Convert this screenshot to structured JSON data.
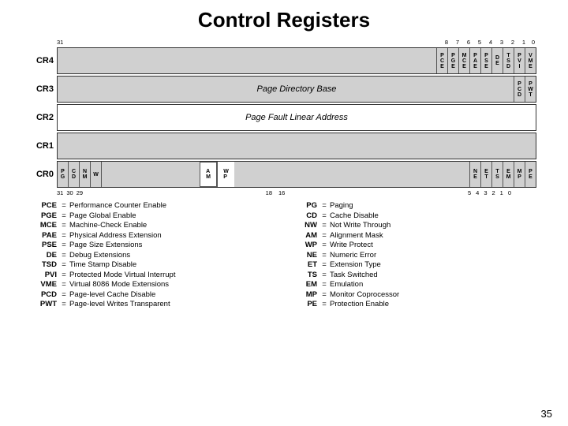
{
  "title": "Control Registers",
  "page_number": "35",
  "diagram": {
    "bit_labels": {
      "b31": "31",
      "b8": "8",
      "b7": "7",
      "b6": "6",
      "b5": "5",
      "b4": "4",
      "b3": "3",
      "b2": "2",
      "b1": "1",
      "b0": "0"
    },
    "bottom_bits": {
      "b31": "31",
      "b30": "30",
      "b29": "29",
      "b18": "18",
      "b16": "16",
      "b5": "5",
      "b4": "4",
      "b3": "3",
      "b2": "2",
      "b1": "1",
      "b0": "0"
    },
    "registers": {
      "cr4": {
        "label": "CR4",
        "bits": [
          "PCE",
          "PGE",
          "MCE",
          "PAE",
          "PSE",
          "DE",
          "TSD",
          "PVI",
          "VME"
        ]
      },
      "cr3": {
        "label": "CR3",
        "text": "Page Directory Base",
        "bits": [
          "PCD",
          "PWT"
        ]
      },
      "cr2": {
        "label": "CR2",
        "text": "Page Fault Linear Address"
      },
      "cr1": {
        "label": "CR1"
      },
      "cr0": {
        "label": "CR0",
        "left_bits": [
          "PG",
          "CD",
          "NM",
          "W"
        ],
        "mid_bits": [
          "AM",
          "WP"
        ],
        "right_bits": [
          "NE",
          "ET",
          "TS",
          "EM",
          "MP",
          "PE"
        ]
      }
    }
  },
  "legend": {
    "left": [
      {
        "abbr": "PCE",
        "desc": "Performance Counter Enable"
      },
      {
        "abbr": "PGE",
        "desc": "Page Global Enable"
      },
      {
        "abbr": "MCE",
        "desc": "Machine-Check Enable"
      },
      {
        "abbr": "PAE",
        "desc": "Physical Address Extension"
      },
      {
        "abbr": "PSE",
        "desc": "Page Size Extensions"
      },
      {
        "abbr": "DE",
        "desc": "Debug Extensions"
      },
      {
        "abbr": "TSD",
        "desc": "Time Stamp Disable"
      },
      {
        "abbr": "PVI",
        "desc": "Protected Mode Virtual Interrupt"
      },
      {
        "abbr": "VME",
        "desc": "Virtual 8086 Mode Extensions"
      },
      {
        "abbr": "PCD",
        "desc": "Page-level Cache Disable"
      },
      {
        "abbr": "PWT",
        "desc": "Page-level Writes Transparent"
      }
    ],
    "right": [
      {
        "abbr": "PG",
        "desc": "Paging"
      },
      {
        "abbr": "CD",
        "desc": "Cache Disable"
      },
      {
        "abbr": "NW",
        "desc": "Not Write Through"
      },
      {
        "abbr": "AM",
        "desc": "Alignment Mask"
      },
      {
        "abbr": "WP",
        "desc": "Write Protect"
      },
      {
        "abbr": "NE",
        "desc": "Numeric Error"
      },
      {
        "abbr": "ET",
        "desc": "Extension Type"
      },
      {
        "abbr": "TS",
        "desc": "Task Switched"
      },
      {
        "abbr": "EM",
        "desc": "Emulation"
      },
      {
        "abbr": "MP",
        "desc": "Monitor Coprocessor"
      },
      {
        "abbr": "PE",
        "desc": "Protection Enable"
      }
    ]
  }
}
